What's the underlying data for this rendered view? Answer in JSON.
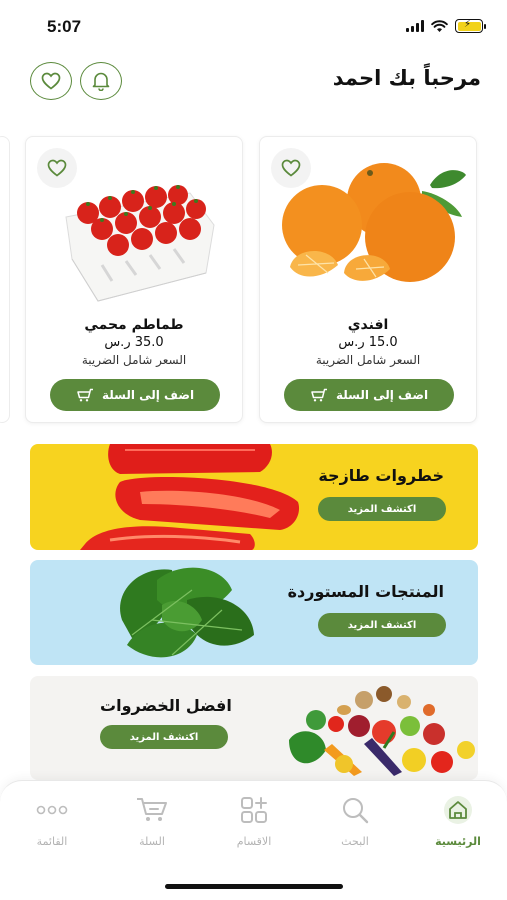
{
  "status_bar": {
    "time": "5:07"
  },
  "header": {
    "greeting": "مرحباً بك احمد"
  },
  "products": [
    {
      "name": "افندي",
      "price": "15.0 ر.س",
      "tax_note": "السعر شامل الضريبة",
      "add_label": "اضف إلى السلة"
    },
    {
      "name": "طماطم محمي",
      "price": "35.0 ر.س",
      "tax_note": "السعر شامل الضريبة",
      "add_label": "اضف إلى السلة"
    }
  ],
  "banners": [
    {
      "title": "خطروات طازجة",
      "button": "اكتشف المزيد"
    },
    {
      "title": "المنتجات المستوردة",
      "button": "اكتشف المزيد"
    },
    {
      "title": "افضل الخضروات",
      "button": "اكتشف المزيد"
    }
  ],
  "bottom_nav": [
    {
      "label": "الرئيسية",
      "icon": "home-icon",
      "active": true
    },
    {
      "label": "البحث",
      "icon": "search-icon"
    },
    {
      "label": "الاقسام",
      "icon": "categories-icon"
    },
    {
      "label": "السلة",
      "icon": "cart-icon"
    },
    {
      "label": "القائمة",
      "icon": "more-icon"
    }
  ],
  "colors": {
    "accent": "#5b8a3c",
    "banner_yellow": "#f7d31f",
    "banner_blue": "#bfe4f5",
    "banner_light": "#f4f3f1"
  }
}
